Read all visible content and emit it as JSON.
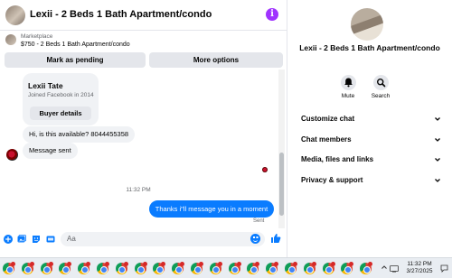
{
  "colors": {
    "accent": "#0a7cff",
    "info_icon": "#a033ff",
    "bubble_in": "#f0f2f5",
    "button_bg": "#e4e6eb"
  },
  "header": {
    "title": "Lexii - 2 Beds 1 Bath Apartment/condo",
    "info_icon": "info-icon"
  },
  "listing": {
    "label": "Marketplace",
    "summary": "$750 - 2 Beds 1 Bath Apartment/condo"
  },
  "actions": {
    "pending_label": "Mark as pending",
    "more_label": "More options"
  },
  "buyer": {
    "name": "Lexii Tate",
    "joined": "Joined Facebook in 2014",
    "details_label": "Buyer details"
  },
  "messages": [
    {
      "text": "Hi, is this available? 8044455358",
      "direction": "in"
    },
    {
      "text": "Message sent",
      "direction": "in"
    }
  ],
  "timestamp": "11:32 PM",
  "outgoing": {
    "text": "Thanks i\"ll message you in a moment",
    "status": "Sent"
  },
  "composer": {
    "placeholder": "Aa"
  },
  "info": {
    "title": "Lexii - 2 Beds 1 Bath Apartment/condo",
    "mute_label": "Mute",
    "search_label": "Search",
    "sections": [
      "Customize chat",
      "Chat members",
      "Media, files and links",
      "Privacy & support"
    ]
  },
  "taskbar": {
    "time": "11:32 PM",
    "date": "3/27/2025",
    "tray_icon": "chevron-up-icon"
  }
}
